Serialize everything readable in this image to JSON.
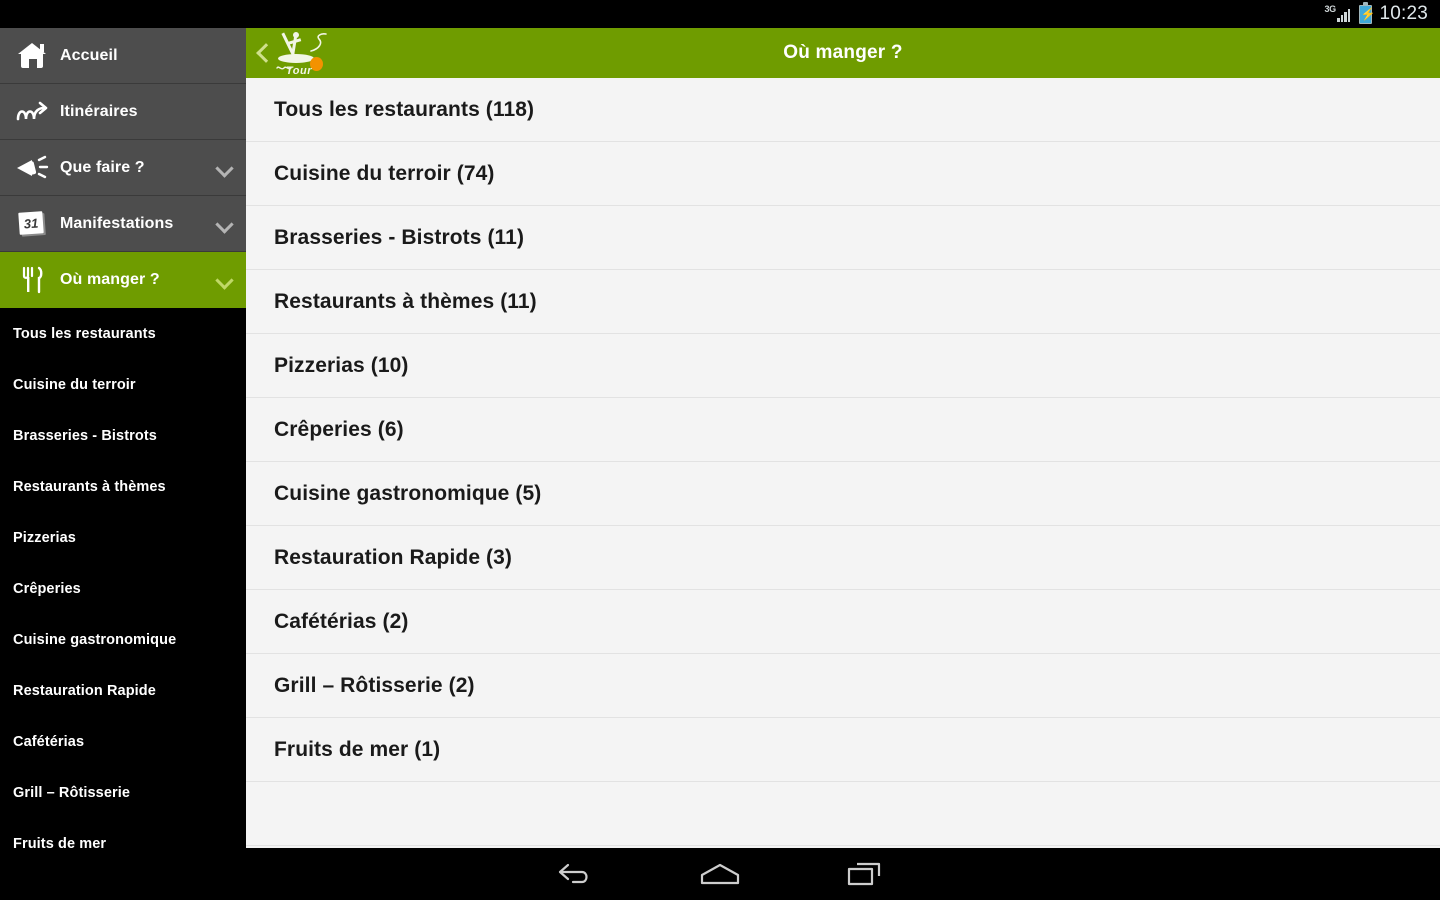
{
  "status_bar": {
    "network_label": "3G",
    "network_icon": "signal-bars-icon",
    "battery_icon": "battery-charging-icon",
    "time": "10:23"
  },
  "theme": {
    "accent_green": "#6f9c00",
    "sidebar_gray": "#4d4d4d",
    "submenu_black": "#000000",
    "list_bg": "#f4f4f4",
    "orange": "#f39200"
  },
  "sidebar": {
    "items": [
      {
        "label": "Accueil",
        "icon": "home-icon",
        "has_chevron": false,
        "active": false
      },
      {
        "label": "Itinéraires",
        "icon": "route-icon",
        "has_chevron": false,
        "active": false
      },
      {
        "label": "Que faire ?",
        "icon": "megaphone-icon",
        "has_chevron": true,
        "active": false
      },
      {
        "label": "Manifestations",
        "icon": "calendar-icon",
        "has_chevron": true,
        "active": false
      },
      {
        "label": "Où manger ?",
        "icon": "cutlery-icon",
        "has_chevron": true,
        "active": true
      }
    ],
    "calendar_day": "31",
    "submenu": [
      {
        "label": "Tous les restaurants"
      },
      {
        "label": "Cuisine du terroir"
      },
      {
        "label": "Brasseries - Bistrots"
      },
      {
        "label": "Restaurants à thèmes"
      },
      {
        "label": "Pizzerias"
      },
      {
        "label": "Crêperies"
      },
      {
        "label": "Cuisine gastronomique"
      },
      {
        "label": "Restauration Rapide"
      },
      {
        "label": "Cafétérias"
      },
      {
        "label": "Grill – Rôtisserie"
      },
      {
        "label": "Fruits de mer"
      }
    ]
  },
  "header": {
    "back_icon": "chevron-left-icon",
    "logo_icon": "paddleboard-logo-icon",
    "logo_text": "Tour",
    "title": "Où manger ?"
  },
  "list": {
    "rows": [
      {
        "label": "Tous les restaurants (118)"
      },
      {
        "label": "Cuisine du terroir (74)"
      },
      {
        "label": "Brasseries - Bistrots (11)"
      },
      {
        "label": "Restaurants à thèmes (11)"
      },
      {
        "label": "Pizzerias (10)"
      },
      {
        "label": "Crêperies (6)"
      },
      {
        "label": "Cuisine gastronomique (5)"
      },
      {
        "label": "Restauration Rapide (3)"
      },
      {
        "label": "Cafétérias (2)"
      },
      {
        "label": "Grill – Rôtisserie (2)"
      },
      {
        "label": "Fruits de mer (1)"
      }
    ]
  },
  "navbar": {
    "buttons": [
      {
        "icon": "back-icon"
      },
      {
        "icon": "home-icon"
      },
      {
        "icon": "recents-icon"
      }
    ]
  }
}
